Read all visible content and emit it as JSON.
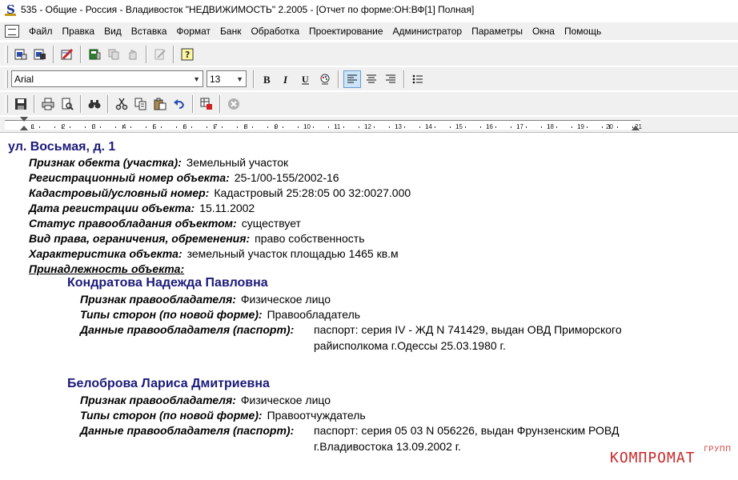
{
  "window": {
    "title": "535 - Общие - Россия - Владивосток \"НЕДВИЖИМОСТЬ\" 2.2005 - [Отчет по форме:ОН:ВФ[1] Полная]"
  },
  "menu": [
    "Файл",
    "Правка",
    "Вид",
    "Вставка",
    "Формат",
    "Банк",
    "Обработка",
    "Проектирование",
    "Администратор",
    "Параметры",
    "Окна",
    "Помощь"
  ],
  "format_toolbar": {
    "font": "Arial",
    "size": "13"
  },
  "ruler": {
    "numbers": [
      "1",
      "2",
      "3",
      "4",
      "5",
      "6",
      "7",
      "8",
      "9",
      "10",
      "11",
      "12",
      "13",
      "14",
      "15",
      "16",
      "17",
      "18",
      "19",
      "20",
      "21"
    ]
  },
  "document": {
    "address": "ул. Восьмая, д. 1",
    "fields": [
      {
        "label": "Признак обекта (участка):",
        "value": "Земельный участок"
      },
      {
        "label": "Регистрационный номер объекта:",
        "value": "25-1/00-155/2002-16"
      },
      {
        "label": "Кадастровый/условный номер:",
        "value": "Кадастровый 25:28:05 00 32:0027.000"
      },
      {
        "label": "Дата регистрации объекта:",
        "value": "15.11.2002"
      },
      {
        "label": "Статус правообладания объектом:",
        "value": "существует"
      },
      {
        "label": "Вид права, ограничения, обременения:",
        "value": "право собственность"
      },
      {
        "label": "Характеристика объекта:",
        "value": "земельный участок площадью 1465 кв.м"
      }
    ],
    "owners_header": "Принадлежность объекта:",
    "owners": [
      {
        "name": "Кондратова Надежда Павловна",
        "type_label": "Признак правообладателя:",
        "type_value": "Физическое лицо",
        "side_label": "Типы сторон (по новой форме):",
        "side_value": "Правообладатель",
        "passport_label": "Данные правообладателя (паспорт):",
        "passport_line1": "паспорт: серия IV - ЖД N 741429, выдан ОВД Приморского",
        "passport_line2": "райисполкома г.Одессы 25.03.1980 г."
      },
      {
        "name": "Белоброва Лариса Дмитриевна",
        "type_label": "Признак правообладателя:",
        "type_value": "Физическое лицо",
        "side_label": "Типы сторон (по новой форме):",
        "side_value": "Правоотчуждатель",
        "passport_label": "Данные правообладателя (паспорт):",
        "passport_line1": "паспорт: серия 05 03 N 056226, выдан Фрунзенским РОВД",
        "passport_line2": "г.Владивостока 13.09.2002 г."
      }
    ]
  },
  "watermark": {
    "main": "КОМПРОМАТ",
    "sub": "ГРУПП"
  },
  "colors": {
    "heading": "#1c1a7a",
    "watermark": "#c82a2a"
  }
}
